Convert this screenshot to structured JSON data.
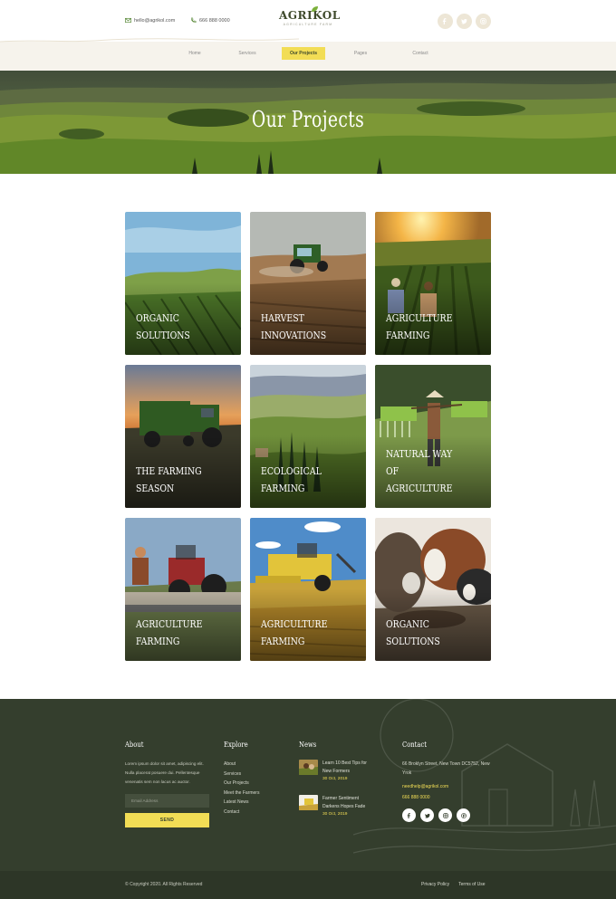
{
  "header": {
    "email": "hello@agrikol.com",
    "phone": "666 888 0000",
    "logo_name": "AGRIKOL",
    "logo_tagline": "AGRICULTURE FARM",
    "social": [
      "facebook-icon",
      "twitter-icon",
      "instagram-icon"
    ],
    "nav": [
      {
        "label": "Home",
        "active": false
      },
      {
        "label": "Services",
        "active": false
      },
      {
        "label": "Our Projects",
        "active": true
      },
      {
        "label": "Pages",
        "active": false
      },
      {
        "label": "Contact",
        "active": false
      }
    ]
  },
  "hero": {
    "title": "Our Projects"
  },
  "projects": [
    {
      "line1": "Organic",
      "line2": "Solutions"
    },
    {
      "line1": "Harvest",
      "line2": "Innovations"
    },
    {
      "line1": "Agriculture",
      "line2": "Farming"
    },
    {
      "line1": "The Farming",
      "line2": "Season"
    },
    {
      "line1": "Ecological",
      "line2": "Farming"
    },
    {
      "line1": "Natural way of",
      "line2": "Agriculture"
    },
    {
      "line1": "Agriculture",
      "line2": "Farming"
    },
    {
      "line1": "Agriculture",
      "line2": "Farming"
    },
    {
      "line1": "Organic",
      "line2": "Solutions"
    }
  ],
  "footer": {
    "about": {
      "heading": "About",
      "text": "Lorem ipsum dolor sit amet, adipiscing elit. Nulla placerat posuere dui. Pellentesque venenatis sem non lacus ac auctor.",
      "email_placeholder": "Email Address",
      "send_label": "SEND"
    },
    "explore": {
      "heading": "Explore",
      "links": [
        "About",
        "Services",
        "Our Projects",
        "Meet the Farmers",
        "Latest News",
        "Contact"
      ]
    },
    "news": {
      "heading": "News",
      "items": [
        {
          "title": "Learn 10 Best Tips for New Formers",
          "date": "30 Oct, 2019"
        },
        {
          "title": "Farmer Sentiment Darkens Hopes Fade",
          "date": "30 Oct, 2019"
        }
      ]
    },
    "contact": {
      "heading": "Contact",
      "address": "66 Broklyn Street, New Town DC5752, New Yrok",
      "email": "needhelp@agrikol.com",
      "phone": "666 888 0000",
      "social": [
        "facebook-icon",
        "twitter-icon",
        "instagram-icon",
        "pinterest-icon"
      ]
    },
    "copyright": "© Copyright 2020. All Rights Reserved",
    "legal": [
      "Privacy Policy",
      "Terms of Use"
    ]
  },
  "colors": {
    "accent": "#f2dd55",
    "dark_green": "#343e2d",
    "bottom_bar": "#2d3627",
    "header_bg": "#f6f3ec"
  }
}
